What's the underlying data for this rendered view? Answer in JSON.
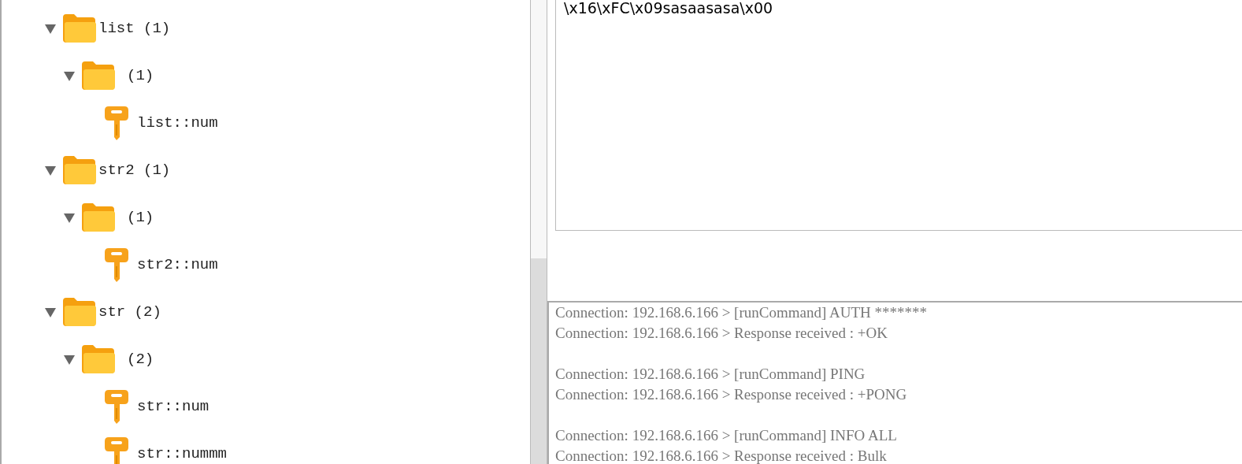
{
  "tree": [
    {
      "kind": "folder",
      "label": "list (1)",
      "expanded": true,
      "children": [
        {
          "kind": "folder",
          "label": "(1)",
          "expanded": true,
          "children": [
            {
              "kind": "key",
              "label": "list::num"
            }
          ]
        }
      ]
    },
    {
      "kind": "folder",
      "label": "str2 (1)",
      "expanded": true,
      "children": [
        {
          "kind": "folder",
          "label": "(1)",
          "expanded": true,
          "children": [
            {
              "kind": "key",
              "label": "str2::num"
            }
          ]
        }
      ]
    },
    {
      "kind": "folder",
      "label": "str (2)",
      "expanded": true,
      "children": [
        {
          "kind": "folder",
          "label": "(2)",
          "expanded": true,
          "children": [
            {
              "kind": "key",
              "label": "str::num"
            },
            {
              "kind": "key",
              "label": "str::nummm"
            }
          ]
        }
      ]
    }
  ],
  "value": {
    "text": "\\x16\\xFC\\x09sasaasasa\\x00"
  },
  "log": [
    {
      "lines": [
        "Connection: 192.168.6.166 > [runCommand] AUTH *******",
        "Connection: 192.168.6.166 > Response received : +OK"
      ]
    },
    {
      "lines": [
        "Connection: 192.168.6.166 > [runCommand] PING",
        "Connection: 192.168.6.166 > Response received : +PONG"
      ]
    },
    {
      "lines": [
        "Connection: 192.168.6.166 > [runCommand] INFO ALL",
        "Connection: 192.168.6.166 > Response received : Bulk"
      ]
    }
  ]
}
